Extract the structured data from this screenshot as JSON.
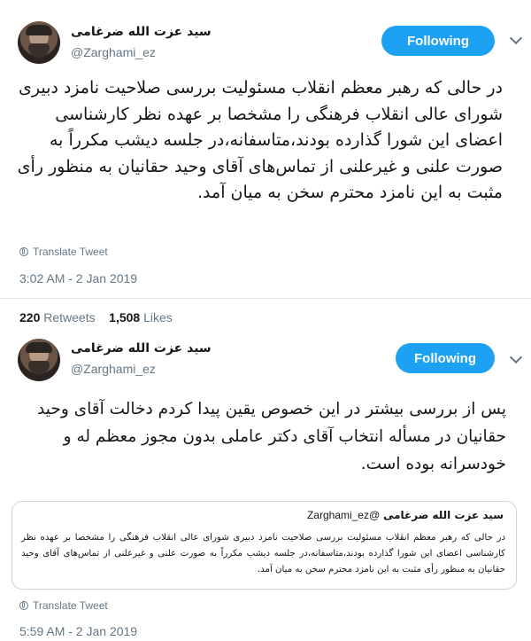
{
  "tweets": [
    {
      "display_name": "سید عزت الله ضرغامی",
      "handle": "@Zarghami_ez",
      "follow_label": "Following",
      "text": "در حالی که رهبر معظم انقلاب مسئولیت بررسی صلاحیت نامزد دبیری شورای عالی انقلاب فرهنگی را مشخصا بر عهده نظر کارشناسی اعضای این شورا گذارده بودند،متاسفانه،در جلسه دیشب مکرراً به صورت علنی و غیرعلنی از تماس‌های آقای وحید حقانیان به منظور رأی مثبت به این نامزد محترم سخن به میان آمد.",
      "translate_label": "Translate Tweet",
      "timestamp": "3:02 AM - 2 Jan 2019",
      "retweets_count": "220",
      "retweets_label": "Retweets",
      "likes_count": "1,508",
      "likes_label": "Likes"
    },
    {
      "display_name": "سید عزت الله ضرغامی",
      "handle": "@Zarghami_ez",
      "follow_label": "Following",
      "text": "پس از بررسی بیشتر در این خصوص یقین پیدا کردم دخالت آقای وحید حقانیان در مسأله انتخاب آقای دکتر عاملی بدون مجوز معظم له و خودسرانه بوده است.",
      "quote": {
        "display_name": "سید عزت الله ضرغامی",
        "handle": "@Zarghami_ez",
        "text": "در حالی که رهبر معظم انقلاب مسئولیت بررسی صلاحیت نامزد دبیری شورای عالی انقلاب فرهنگی را مشخصا بر عهده نظر کارشناسی اعضای این شورا گذارده بودند،متاسفانه،در جلسه دیشب مکرراً به صورت علنی و غیرعلنی از تماس‌های آقای وحید حقانیان به منظور رأی مثبت به این نامزد محترم سخن به میان آمد."
      },
      "translate_label": "Translate Tweet",
      "timestamp": "5:59 AM - 2 Jan 2019"
    }
  ]
}
